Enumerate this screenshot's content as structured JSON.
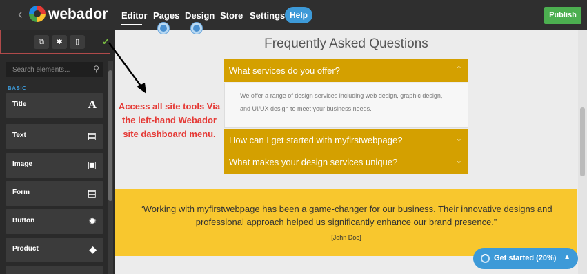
{
  "topbar": {
    "back_icon": "chevron-left-icon",
    "brand": "webador",
    "nav": [
      "Editor",
      "Pages",
      "Design",
      "Store",
      "Settings"
    ],
    "help": "Help",
    "publish": "Publish"
  },
  "sidebar": {
    "tools": [
      {
        "icon": "external-link-icon",
        "glyph": "⧉"
      },
      {
        "icon": "gear-icon",
        "glyph": "✱"
      },
      {
        "icon": "mobile-icon",
        "glyph": "▯"
      }
    ],
    "check": "✓",
    "search_placeholder": "Search elements...",
    "section": "BASIC",
    "items": [
      {
        "label": "Title",
        "glyph": "A",
        "icon": "title-icon"
      },
      {
        "label": "Text",
        "glyph": "▤",
        "icon": "text-icon"
      },
      {
        "label": "Image",
        "glyph": "▣",
        "icon": "image-icon"
      },
      {
        "label": "Form",
        "glyph": "▤",
        "icon": "form-icon"
      },
      {
        "label": "Button",
        "glyph": "✹",
        "icon": "button-icon"
      },
      {
        "label": "Product",
        "glyph": "◆",
        "icon": "tag-icon"
      }
    ]
  },
  "canvas": {
    "title": "Frequently Asked Questions",
    "faq": [
      {
        "question": "What services do you offer?",
        "chevron": "⌃"
      },
      {
        "question": "How can I get started with myfirstwebpage?",
        "chevron": "⌄"
      },
      {
        "question": "What makes your design services unique?",
        "chevron": "⌄"
      }
    ],
    "answer": "We offer a range of design services including web design, graphic design, and UI/UX design to meet your business needs.",
    "quote": "“Working with myfirstwebpage has been a game-changer for our business. Their innovative designs and professional approach helped us significantly enhance our brand presence.”",
    "author": "[John Doe]"
  },
  "annotation": "Access all site tools Via the left-hand Webador site dashboard menu.",
  "get_started": {
    "label": "Get started (20%)",
    "progress": 0.2,
    "caret": "▲"
  },
  "colors": {
    "accent": "#3d9ad8",
    "faq": "#d4a000",
    "band": "#f8c72e",
    "publish": "#4caf50",
    "annotation": "#e53935"
  }
}
